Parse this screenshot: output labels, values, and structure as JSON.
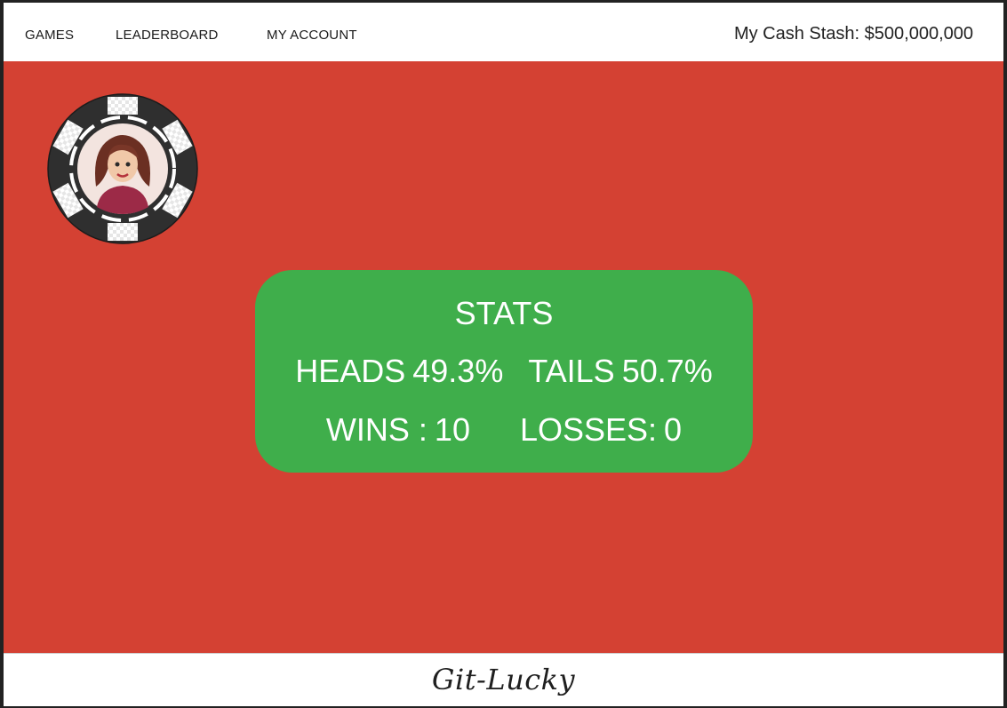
{
  "nav": {
    "items": [
      {
        "label": "GAMES"
      },
      {
        "label": "LEADERBOARD"
      },
      {
        "label": "MY ACCOUNT"
      }
    ],
    "cash_stash": "My Cash Stash: $500,000,000"
  },
  "avatar": {
    "icon": "poker-chip-avatar-icon"
  },
  "stats": {
    "title": "STATS",
    "heads_label": "HEADS",
    "heads_value": "49.3%",
    "tails_label": "TAILS",
    "tails_value": "50.7%",
    "wins_label": "WINS :",
    "wins_value": "10",
    "losses_label": "LOSSES:",
    "losses_value": "0"
  },
  "footer": {
    "brand": "Git-Lucky"
  },
  "colors": {
    "main_background": "#d44133",
    "stats_background": "#3fae4b",
    "chip_dark": "#333333",
    "chip_light": "#ffffff"
  }
}
